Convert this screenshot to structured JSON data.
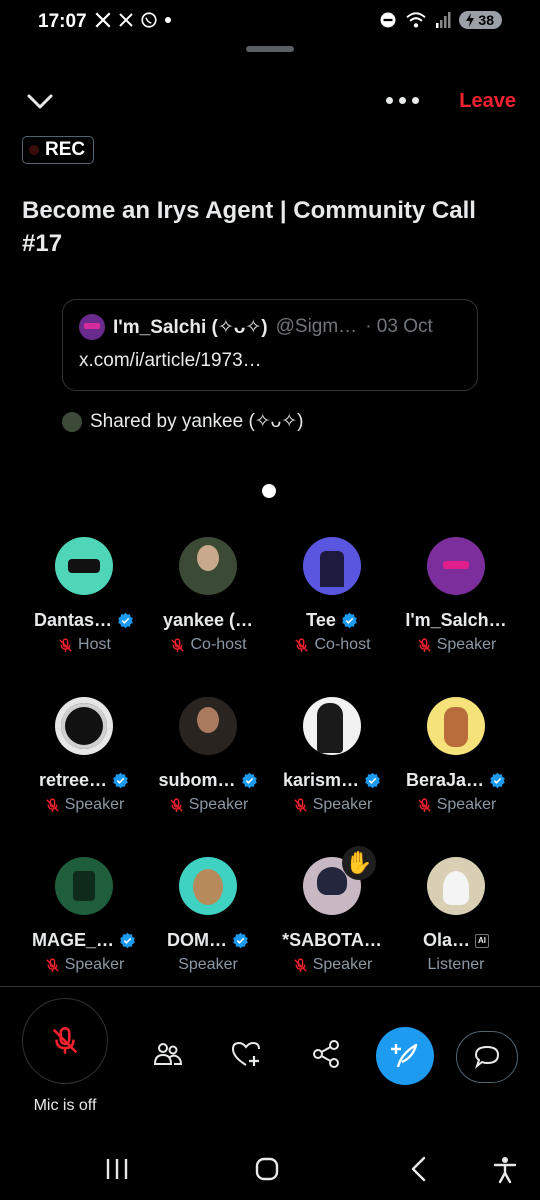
{
  "status_bar": {
    "time": "17:07",
    "battery": "38",
    "left_icons": [
      "x-logo-icon",
      "x-logo-icon",
      "whatsapp-icon",
      "dot-icon"
    ],
    "right_icons": [
      "dnd-icon",
      "wifi-icon",
      "signal-icon",
      "battery-icon"
    ]
  },
  "header": {
    "leave_label": "Leave",
    "rec_label": "REC",
    "title": "Become an Irys Agent | Community Call #17"
  },
  "shared_post": {
    "author_name": "I'm_Salchi (✧ᴗ✧)",
    "author_handle": "@Sigm…",
    "date": "· 03 Oct",
    "link": "x.com/i/article/1973…",
    "shared_by": "Shared by yankee (✧ᴗ✧)"
  },
  "participants": [
    {
      "name": "Dantas…",
      "role": "Host",
      "verified": true,
      "muted": true,
      "avatar": "av-dantas"
    },
    {
      "name": "yankee (…",
      "role": "Co-host",
      "verified": false,
      "muted": true,
      "avatar": "av-yankee"
    },
    {
      "name": "Tee",
      "role": "Co-host",
      "verified": true,
      "muted": true,
      "avatar": "av-tee"
    },
    {
      "name": "I'm_Salch…",
      "role": "Speaker",
      "verified": false,
      "muted": true,
      "avatar": "av-salchi"
    },
    {
      "name": "retree…",
      "role": "Speaker",
      "verified": true,
      "muted": true,
      "avatar": "av-retree"
    },
    {
      "name": "subom…",
      "role": "Speaker",
      "verified": true,
      "muted": true,
      "avatar": "av-subom"
    },
    {
      "name": "karism…",
      "role": "Speaker",
      "verified": true,
      "muted": true,
      "avatar": "av-karism"
    },
    {
      "name": "BeraJa…",
      "role": "Speaker",
      "verified": true,
      "muted": true,
      "avatar": "av-bera"
    },
    {
      "name": "MAGE_…",
      "role": "Speaker",
      "verified": true,
      "muted": true,
      "avatar": "av-mage"
    },
    {
      "name": "DOM…",
      "role": "Speaker",
      "verified": true,
      "muted": false,
      "avatar": "av-dom"
    },
    {
      "name": "*SABOTA…",
      "role": "Speaker",
      "verified": false,
      "muted": true,
      "avatar": "av-sabota",
      "hand_raised": true,
      "hand_emoji": "✋"
    },
    {
      "name": "Ola…",
      "role": "Listener",
      "verified": false,
      "muted": false,
      "avatar": "av-ola",
      "bot": true,
      "bot_label": "AI"
    }
  ],
  "dock": {
    "mic_label": "Mic is off",
    "buttons": [
      "people-icon",
      "heart-add-icon",
      "share-icon",
      "compose-icon",
      "chat-icon"
    ]
  },
  "colors": {
    "accent": "#1d9bf0",
    "leave": "#f4212e",
    "muted_mic": "#f4212e",
    "secondary_text": "#8b98a5"
  }
}
